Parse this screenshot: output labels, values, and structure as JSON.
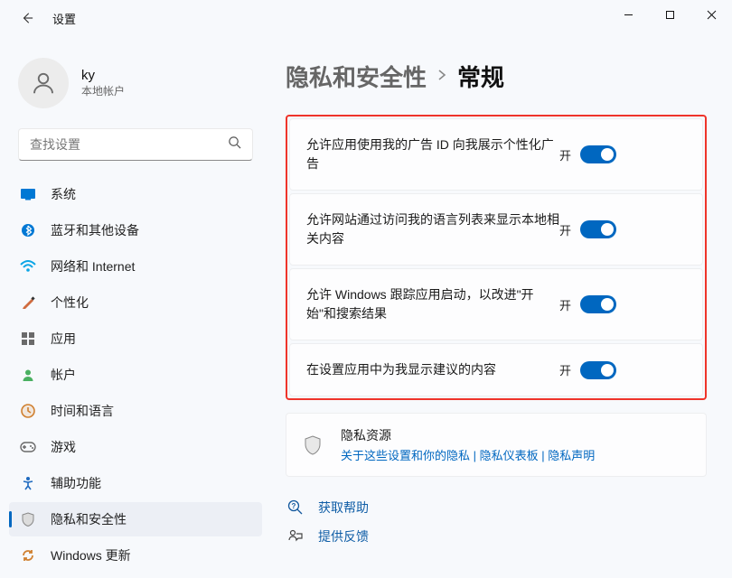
{
  "window": {
    "title": "设置"
  },
  "user": {
    "name": "ky",
    "subtitle": "本地帐户"
  },
  "search": {
    "placeholder": "查找设置"
  },
  "sidebar": {
    "items": [
      {
        "label": "系统",
        "icon": "system",
        "color": "#0078d4"
      },
      {
        "label": "蓝牙和其他设备",
        "icon": "bluetooth",
        "color": "#0078d4"
      },
      {
        "label": "网络和 Internet",
        "icon": "network",
        "color": "#0ba5e6"
      },
      {
        "label": "个性化",
        "icon": "personalization",
        "color": "#d06c3f"
      },
      {
        "label": "应用",
        "icon": "apps",
        "color": "#6a6a6a"
      },
      {
        "label": "帐户",
        "icon": "accounts",
        "color": "#4ab061"
      },
      {
        "label": "时间和语言",
        "icon": "time",
        "color": "#d08030"
      },
      {
        "label": "游戏",
        "icon": "gaming",
        "color": "#6a6a6a"
      },
      {
        "label": "辅助功能",
        "icon": "accessibility",
        "color": "#1f6abf"
      },
      {
        "label": "隐私和安全性",
        "icon": "privacy",
        "color": "#6b6b6b",
        "active": true
      },
      {
        "label": "Windows 更新",
        "icon": "update",
        "color": "#d08030"
      }
    ]
  },
  "breadcrumb": {
    "parent": "隐私和安全性",
    "current": "常规"
  },
  "settings": [
    {
      "label": "允许应用使用我的广告 ID 向我展示个性化广告",
      "state": "开",
      "on": true
    },
    {
      "label": "允许网站通过访问我的语言列表来显示本地相关内容",
      "state": "开",
      "on": true
    },
    {
      "label": "允许 Windows 跟踪应用启动，以改进\"开始\"和搜索结果",
      "state": "开",
      "on": true
    },
    {
      "label": "在设置应用中为我显示建议的内容",
      "state": "开",
      "on": true
    }
  ],
  "resources": {
    "title": "隐私资源",
    "links": [
      "关于这些设置和你的隐私",
      "隐私仪表板",
      "隐私声明"
    ],
    "separator": " | "
  },
  "footer": {
    "help": "获取帮助",
    "feedback": "提供反馈"
  }
}
